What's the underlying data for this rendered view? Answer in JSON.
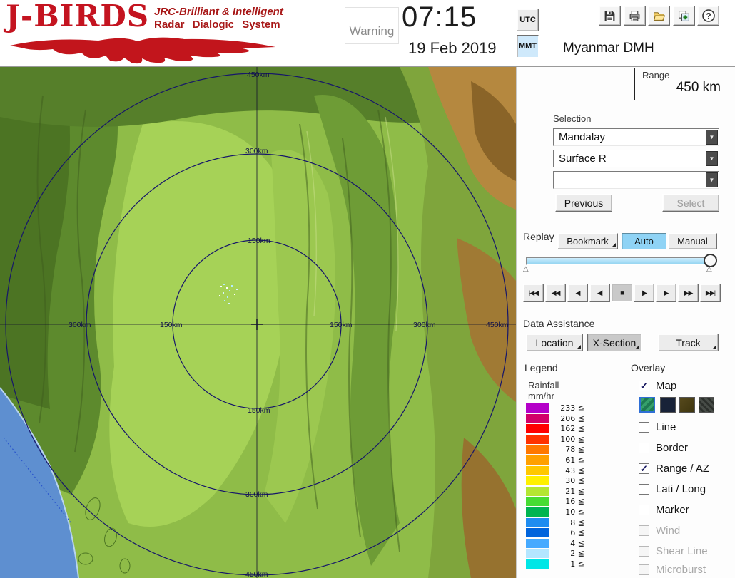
{
  "header": {
    "logo": {
      "title": "J-BIRDS",
      "tagline1": "JRC-Brilliant & Intelligent",
      "tagline2": "Radar Dialogic System"
    },
    "warning_label": "Warning",
    "clock": {
      "time": "07:15",
      "date": "19 Feb 2019"
    },
    "timezone": {
      "utc_label": "UTC",
      "mmt_label": "MMT",
      "selected": "MMT"
    },
    "toolbar": {
      "icons": [
        "save",
        "print",
        "open-folder",
        "add-window",
        "help"
      ],
      "help_glyph": "?"
    }
  },
  "map": {
    "v_labels": [
      "450km",
      "300km",
      "150km",
      "150km",
      "300km",
      "450km"
    ],
    "h_labels": [
      "300km",
      "150km",
      "150km",
      "300km",
      "450km"
    ],
    "echo_color": "#b4ecff"
  },
  "panel": {
    "station_title": "Myanmar DMH",
    "range": {
      "label": "Range",
      "value": "450 km"
    },
    "selection": {
      "label": "Selection",
      "combo1": "Mandalay",
      "combo2": "Surface R",
      "combo3": ""
    },
    "previous_label": "Previous",
    "select_label": "Select",
    "replay": {
      "label": "Replay",
      "bookmark_label": "Bookmark",
      "auto_label": "Auto",
      "manual_label": "Manual",
      "transport": [
        "|◀◀",
        "◀◀",
        "◀",
        "◀|",
        "■",
        "|▶",
        "▶",
        "▶▶",
        "▶▶|"
      ]
    },
    "data_assistance": {
      "label": "Data Assistance",
      "location_label": "Location",
      "xsection_label": "X-Section",
      "track_label": "Track"
    },
    "legend": {
      "label": "Legend",
      "unit_line1": "Rainfall",
      "unit_line2": "mm/hr",
      "scale": [
        {
          "label": "233 ≦",
          "color": "#b400c8"
        },
        {
          "label": "206 ≦",
          "color": "#d20069"
        },
        {
          "label": "162 ≦",
          "color": "#ff0000"
        },
        {
          "label": "100 ≦",
          "color": "#ff3200"
        },
        {
          "label": "78 ≦",
          "color": "#ff7800"
        },
        {
          "label": "61 ≦",
          "color": "#ffa000"
        },
        {
          "label": "43 ≦",
          "color": "#ffc800"
        },
        {
          "label": "30 ≦",
          "color": "#fff000"
        },
        {
          "label": "21 ≦",
          "color": "#b4e632"
        },
        {
          "label": "16 ≦",
          "color": "#46dc32"
        },
        {
          "label": "10 ≦",
          "color": "#00b450"
        },
        {
          "label": "8 ≦",
          "color": "#1e8cf0"
        },
        {
          "label": "6 ≦",
          "color": "#0064dc"
        },
        {
          "label": "4 ≦",
          "color": "#46aaff"
        },
        {
          "label": "2 ≦",
          "color": "#b4e6ff"
        },
        {
          "label": "1 ≦",
          "color": "#00e6e6"
        }
      ]
    },
    "overlay": {
      "label": "Overlay",
      "items": [
        {
          "label": "Map",
          "mark": "✓",
          "enabled": true
        },
        {
          "label": "Line",
          "mark": "",
          "enabled": true
        },
        {
          "label": "Border",
          "mark": "",
          "enabled": true
        },
        {
          "label": "Range / AZ",
          "mark": "✓",
          "enabled": true
        },
        {
          "label": "Lati / Long",
          "mark": "",
          "enabled": true
        },
        {
          "label": "Marker",
          "mark": "",
          "enabled": true
        },
        {
          "label": "Wind",
          "mark": "",
          "enabled": false
        },
        {
          "label": "Shear Line",
          "mark": "",
          "enabled": false
        },
        {
          "label": "Microburst",
          "mark": "",
          "enabled": false
        }
      ],
      "map_style_colors": [
        "#2e9c66",
        "#182238",
        "#56491c",
        "#3a3f3a"
      ]
    }
  }
}
